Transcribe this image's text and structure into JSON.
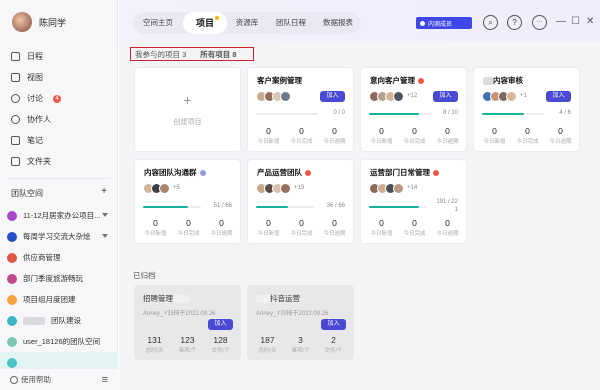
{
  "user": {
    "name": "陈同学"
  },
  "nav": [
    {
      "label": "日程",
      "icon": "calendar-icon"
    },
    {
      "label": "视图",
      "icon": "view-icon"
    },
    {
      "label": "讨论",
      "icon": "discussion-icon",
      "badge": "4"
    },
    {
      "label": "协作人",
      "icon": "people-icon"
    },
    {
      "label": "笔记",
      "icon": "note-icon"
    },
    {
      "label": "文件夹",
      "icon": "folder-icon"
    }
  ],
  "team_space": {
    "label": "团队空间",
    "add": "+"
  },
  "spaces": [
    {
      "label": "11-12月居家办公项目...",
      "color": "#a64ac9",
      "expand": true
    },
    {
      "label": "每周学习交流大杂烩",
      "color": "#2850c8",
      "expand": true
    },
    {
      "label": "供应商管理",
      "color": "#e2574c",
      "expand": false
    },
    {
      "label": "部门季度旅游畅玩",
      "color": "#c04b8c",
      "expand": false
    },
    {
      "label": "项目组月度团建",
      "color": "#f2a33a",
      "expand": false
    },
    {
      "label": "团队建设",
      "color": "#3cb6c4",
      "expand": false
    },
    {
      "label": "user_18126的团队空间",
      "color": "#7dc9b4",
      "expand": false
    },
    {
      "label": "",
      "color": "#4dc3c3",
      "expand": false
    }
  ],
  "bottom": {
    "help": "使用帮助",
    "menu": "≡"
  },
  "tabs": [
    {
      "label": "空间主页",
      "active": false
    },
    {
      "label": "项目",
      "active": true
    },
    {
      "label": "资源库",
      "active": false
    },
    {
      "label": "团队日程",
      "active": false
    },
    {
      "label": "数据报表",
      "active": false
    }
  ],
  "topbar": {
    "inner_btn": "内测成员",
    "search": "⌕",
    "help": "?",
    "more": "···",
    "min": "—",
    "max": "☐",
    "close": "✕"
  },
  "filter": {
    "mine_label": "我参与的项目",
    "mine_count": "3",
    "all_label": "所有项目",
    "all_count": "8"
  },
  "create_label": "创建项目",
  "create_plus": "+",
  "projects": [
    {
      "title": "客户案例管理",
      "tag_color": "",
      "extra": "",
      "ratio": "0 / 0",
      "progress": 0,
      "stats": [
        "0",
        "0",
        "0"
      ]
    },
    {
      "title": "意向客户管理",
      "tag_color": "#f5574a",
      "extra": "+12",
      "ratio": "8 / 10",
      "progress": 80,
      "stats": [
        "0",
        "0",
        "0"
      ]
    },
    {
      "title": "内容审核",
      "tag_color": "",
      "extra": "+1",
      "ratio": "4 / 6",
      "progress": 67,
      "stats": [
        "0",
        "0",
        "0"
      ]
    },
    {
      "title": "内容团队沟通群",
      "tag_color": "#8f9bd8",
      "extra": "+5",
      "ratio": "51 / 66",
      "progress": 77,
      "stats": [
        "0",
        "0",
        "0"
      ]
    },
    {
      "title": "产品运营团队",
      "tag_color": "#f5574a",
      "extra": "+19",
      "ratio": "36 / 66",
      "progress": 55,
      "stats": [
        "0",
        "0",
        "0"
      ]
    },
    {
      "title": "运营部门日常管理",
      "tag_color": "#f5574a",
      "extra": "+14",
      "ratio": "191 / 221",
      "progress": 86,
      "stats": [
        "0",
        "0",
        "0"
      ]
    }
  ],
  "join_label": "加入",
  "stat_labels": [
    "今日新增",
    "今日完成",
    "今日逾期"
  ],
  "archived": {
    "heading": "已归档",
    "cards": [
      {
        "title": "招聘管理",
        "sub": "Anney_Y归档于2022.09.26",
        "stats": [
          "131",
          "123",
          "128"
        ]
      },
      {
        "title": "抖音运营",
        "sub": "Anney_Y归档于2022.09.26",
        "stats": [
          "187",
          "3",
          "2"
        ]
      }
    ],
    "stat_labels": [
      "总时/天",
      "事项/个",
      "文件/个"
    ]
  }
}
